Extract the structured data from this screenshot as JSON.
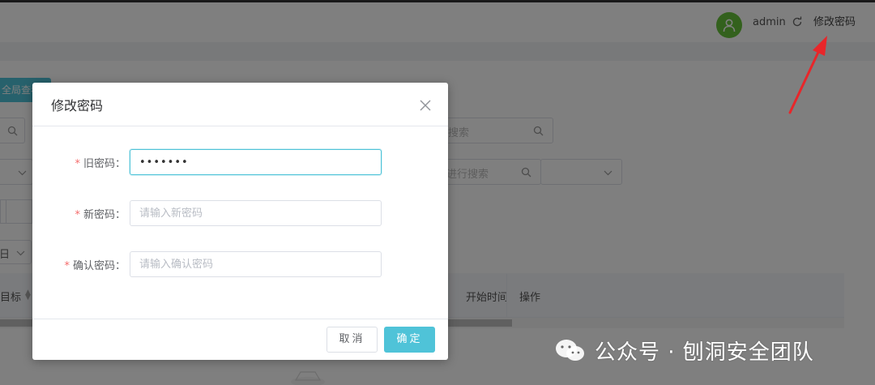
{
  "header": {
    "username": "admin",
    "change_password_link": "修改密码",
    "icons": [
      "user-avatar-icon",
      "refresh-icon"
    ]
  },
  "background": {
    "global_button_label": "全局查看",
    "search_placeholder_1": "搜索",
    "search_placeholder_2": "进行搜索",
    "filter_label": "日",
    "table_headers": [
      "目标",
      "开始时间",
      "操作"
    ]
  },
  "dialog": {
    "title": "修改密码",
    "fields": [
      {
        "label": "旧密码：",
        "required": true,
        "value": "•••••••",
        "placeholder": ""
      },
      {
        "label": "新密码：",
        "required": true,
        "value": "",
        "placeholder": "请输入新密码"
      },
      {
        "label": "确认密码：",
        "required": true,
        "value": "",
        "placeholder": "请输入确认密码"
      }
    ],
    "cancel_label": "取消",
    "confirm_label": "确定"
  },
  "watermark": {
    "text": "公众号 · 刨洞安全团队"
  },
  "colors": {
    "accent": "#4fc3d8",
    "required": "#f56c6c",
    "avatar": "#67c23a",
    "annotation_arrow": "#e8262a"
  }
}
